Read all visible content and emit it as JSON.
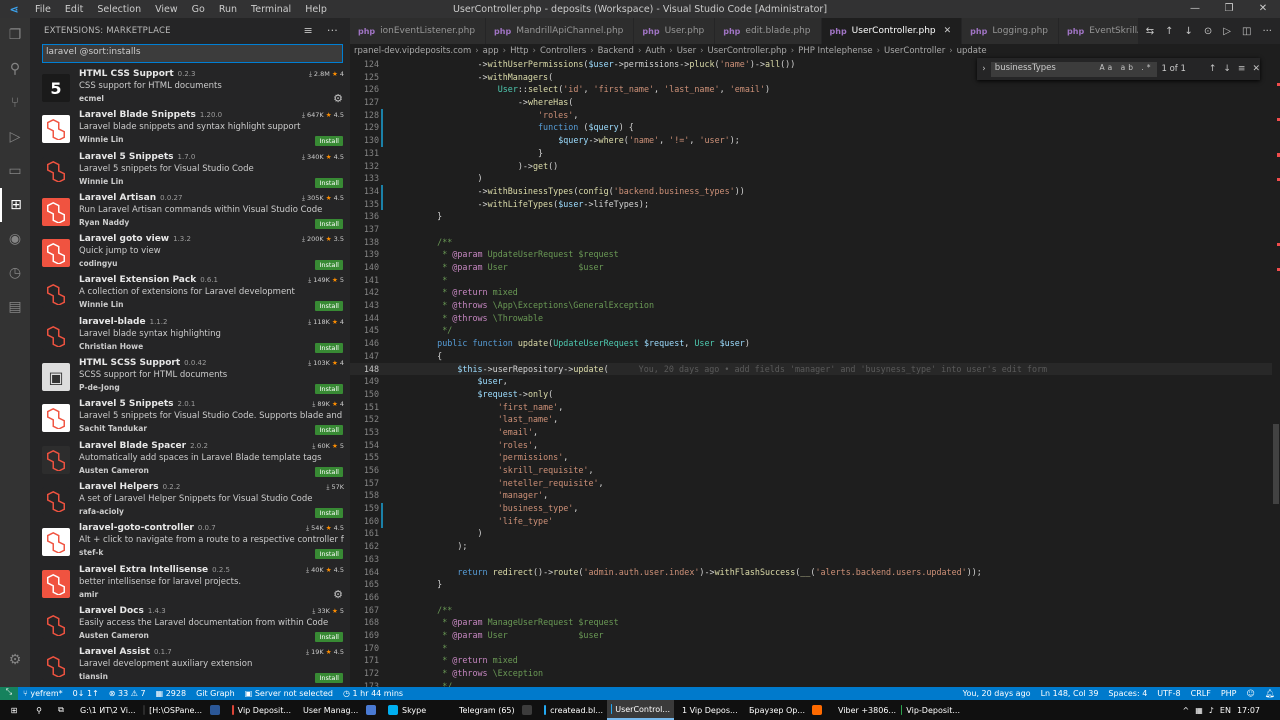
{
  "titlebar": {
    "menu": [
      "File",
      "Edit",
      "Selection",
      "View",
      "Go",
      "Run",
      "Terminal",
      "Help"
    ],
    "title": "UserController.php - deposits (Workspace) - Visual Studio Code [Administrator]"
  },
  "sidebar": {
    "title": "EXTENSIONS: MARKETPLACE",
    "search_value": "laravel @sort:installs",
    "extensions": [
      {
        "name": "HTML CSS Support",
        "version": "0.2.3",
        "desc": "CSS support for HTML documents",
        "publisher": "ecmel",
        "downloads": "2.8M",
        "rating": "4",
        "action": "gear",
        "icon": "html5-icon",
        "color": "#1a1a1a"
      },
      {
        "name": "Laravel Blade Snippets",
        "version": "1.20.0",
        "desc": "Laravel blade snippets and syntax highlight support",
        "publisher": "Winnie Lin",
        "downloads": "647K",
        "rating": "4.5",
        "action": "Install",
        "icon": "laravel-icon",
        "color": "#ffffff"
      },
      {
        "name": "Laravel 5 Snippets",
        "version": "1.7.0",
        "desc": "Laravel 5 snippets for Visual Studio Code",
        "publisher": "Winnie Lin",
        "downloads": "340K",
        "rating": "4.5",
        "action": "Install",
        "icon": "laravel-icon",
        "color": "#252526"
      },
      {
        "name": "Laravel Artisan",
        "version": "0.0.27",
        "desc": "Run Laravel Artisan commands within Visual Studio Code",
        "publisher": "Ryan Naddy",
        "downloads": "305K",
        "rating": "4.5",
        "action": "Install",
        "icon": "laravel-icon",
        "color": "#f05340"
      },
      {
        "name": "Laravel goto view",
        "version": "1.3.2",
        "desc": "Quick jump to view",
        "publisher": "codingyu",
        "downloads": "200K",
        "rating": "3.5",
        "action": "Install",
        "icon": "laravel-icon",
        "color": "#f05340"
      },
      {
        "name": "Laravel Extension Pack",
        "version": "0.6.1",
        "desc": "A collection of extensions for Laravel development",
        "publisher": "Winnie Lin",
        "downloads": "149K",
        "rating": "5",
        "action": "Install",
        "icon": "laravel-icon",
        "color": "#252526"
      },
      {
        "name": "laravel-blade",
        "version": "1.1.2",
        "desc": "Laravel blade syntax highlighting",
        "publisher": "Christian Howe",
        "downloads": "118K",
        "rating": "4",
        "action": "Install",
        "icon": "laravel-icon",
        "color": "#252526"
      },
      {
        "name": "HTML SCSS Support",
        "version": "0.0.42",
        "desc": "SCSS support for HTML documents",
        "publisher": "P-de-Jong",
        "downloads": "103K",
        "rating": "4",
        "action": "Install",
        "icon": "scss-icon",
        "color": "#dddddd"
      },
      {
        "name": "Laravel 5 Snippets",
        "version": "2.0.1",
        "desc": "Laravel 5 snippets for Visual Studio Code. Supports blade and Larav...",
        "publisher": "Sachit Tandukar",
        "downloads": "89K",
        "rating": "4",
        "action": "Install",
        "icon": "laravel-icon",
        "color": "#ffffff"
      },
      {
        "name": "Laravel Blade Spacer",
        "version": "2.0.2",
        "desc": "Automatically add spaces in Laravel Blade template tags",
        "publisher": "Austen Cameron",
        "downloads": "60K",
        "rating": "5",
        "action": "Install",
        "icon": "laravel-icon",
        "color": "#2d2d2d"
      },
      {
        "name": "Laravel Helpers",
        "version": "0.2.2",
        "desc": "A set of Laravel Helper Snippets for Visual Studio Code",
        "publisher": "rafa-acioly",
        "downloads": "57K",
        "rating": "",
        "action": "Install",
        "icon": "laravel-icon",
        "color": "#252526"
      },
      {
        "name": "laravel-goto-controller",
        "version": "0.0.7",
        "desc": "Alt + click to navigate from a route to a respective controller file",
        "publisher": "stef-k",
        "downloads": "54K",
        "rating": "4.5",
        "action": "Install",
        "icon": "laravel-icon",
        "color": "#ffffff"
      },
      {
        "name": "Laravel Extra Intellisense",
        "version": "0.2.5",
        "desc": "better intellisense for laravel projects.",
        "publisher": "amir",
        "downloads": "40K",
        "rating": "4.5",
        "action": "gear",
        "icon": "laravel-icon",
        "color": "#f05340"
      },
      {
        "name": "Laravel Docs",
        "version": "1.4.3",
        "desc": "Easily access the Laravel documentation from within Code",
        "publisher": "Austen Cameron",
        "downloads": "33K",
        "rating": "5",
        "action": "Install",
        "icon": "laravel-icon",
        "color": "#252526"
      },
      {
        "name": "Laravel Assist",
        "version": "0.1.7",
        "desc": "Laravel development auxiliary extension",
        "publisher": "tiansin",
        "downloads": "19K",
        "rating": "4.5",
        "action": "Install",
        "icon": "laravel-icon",
        "color": "#252526"
      }
    ]
  },
  "tabs": [
    {
      "label": "ionEventListener.php",
      "active": false
    },
    {
      "label": "MandrillApiChannel.php",
      "active": false
    },
    {
      "label": "User.php",
      "active": false
    },
    {
      "label": "edit.blade.php",
      "active": false
    },
    {
      "label": "UserController.php",
      "active": true
    },
    {
      "label": "Logging.php",
      "active": false
    },
    {
      "label": "EventSkrillApplicationChange.p",
      "active": false
    }
  ],
  "breadcrumb": [
    "rpanel-dev.vipdeposits.com",
    "app",
    "Http",
    "Controllers",
    "Backend",
    "Auth",
    "User",
    "UserController.php",
    "PHP Intelephense",
    "UserController",
    "update"
  ],
  "find": {
    "value": "businessTypes",
    "result": "1 of 1"
  },
  "blame": "You, 20 days ago • add fields 'manager' and 'busyness_type' into user's edit form",
  "code_start": 124,
  "code_lines": [
    "            ->withUserPermissions($user->permissions->pluck('name')->all())",
    "            ->withManagers(",
    "                User::select('id', 'first_name', 'last_name', 'email')",
    "                    ->whereHas(",
    "                        'roles',",
    "                        function ($query) {",
    "                            $query->where('name', '!=', 'user');",
    "                        }",
    "                    )->get()",
    "            )",
    "            ->withBusinessTypes(config('backend.business_types'))",
    "            ->withLifeTypes($user->lifeTypes);",
    "    }",
    "",
    "    /**",
    "     * @param UpdateUserRequest $request",
    "     * @param User              $user",
    "     *",
    "     * @return mixed",
    "     * @throws \\App\\Exceptions\\GeneralException",
    "     * @throws \\Throwable",
    "     */",
    "    public function update(UpdateUserRequest $request, User $user)",
    "    {",
    "        $this->userRepository->update(",
    "            $user,",
    "            $request->only(",
    "                'first_name',",
    "                'last_name',",
    "                'email',",
    "                'roles',",
    "                'permissions',",
    "                'skrill_requisite',",
    "                'neteller_requisite',",
    "                'manager',",
    "                'business_type',",
    "                'life_type'",
    "            )",
    "        );",
    "",
    "        return redirect()->route('admin.auth.user.index')->withFlashSuccess(__('alerts.backend.users.updated'));",
    "    }",
    "",
    "    /**",
    "     * @param ManageUserRequest $request",
    "     * @param User              $user",
    "     *",
    "     * @return mixed",
    "     * @throws \\Exception",
    "     */"
  ],
  "current_line": 148,
  "statusbar": {
    "branch": "yefrem*",
    "sync": "0↓ 1↑",
    "errors": "33",
    "warnings": "7",
    "count": "2928",
    "git_graph": "Git Graph",
    "server": "Server not selected",
    "time": "1 hr 44 mins",
    "blame": "You, 20 days ago",
    "position": "Ln 148, Col 39",
    "spaces": "Spaces: 4",
    "encoding": "UTF-8",
    "eol": "CRLF",
    "lang": "PHP"
  },
  "taskbar": {
    "apps": [
      {
        "label": "G:\\1 ИТ\\2 Vi...",
        "color": "#f4c542",
        "active": false
      },
      {
        "label": "[H:\\OSPane...",
        "color": "#2b2b2b",
        "active": false
      },
      {
        "label": "",
        "color": "#2b5797",
        "active": false
      },
      {
        "label": "Vip Deposit...",
        "color": "#db4437",
        "active": false
      },
      {
        "label": "User Manag...",
        "color": "#db4437",
        "active": false
      },
      {
        "label": "",
        "color": "#4a7bd4",
        "active": false
      },
      {
        "label": "Skype",
        "color": "#00aff0",
        "active": false
      },
      {
        "label": "Telegram (65)",
        "color": "#2ca5e0",
        "active": false
      },
      {
        "label": "",
        "color": "#3c3c3c",
        "active": false
      },
      {
        "label": "createad.bl...",
        "color": "#23a9f2",
        "active": false
      },
      {
        "label": "UserControl...",
        "color": "#23a9f2",
        "active": true
      },
      {
        "label": "1 Vip Depos...",
        "color": "#1ea362",
        "active": false
      },
      {
        "label": "Браузер Op...",
        "color": "#ff1b2d",
        "active": false
      },
      {
        "label": "",
        "color": "#ff6a00",
        "active": false
      },
      {
        "label": "Viber +3806...",
        "color": "#7360f2",
        "active": false
      },
      {
        "label": "Vip-Deposit...",
        "color": "#2ea44f",
        "active": false
      }
    ],
    "lang": "EN",
    "time": "17:07"
  }
}
